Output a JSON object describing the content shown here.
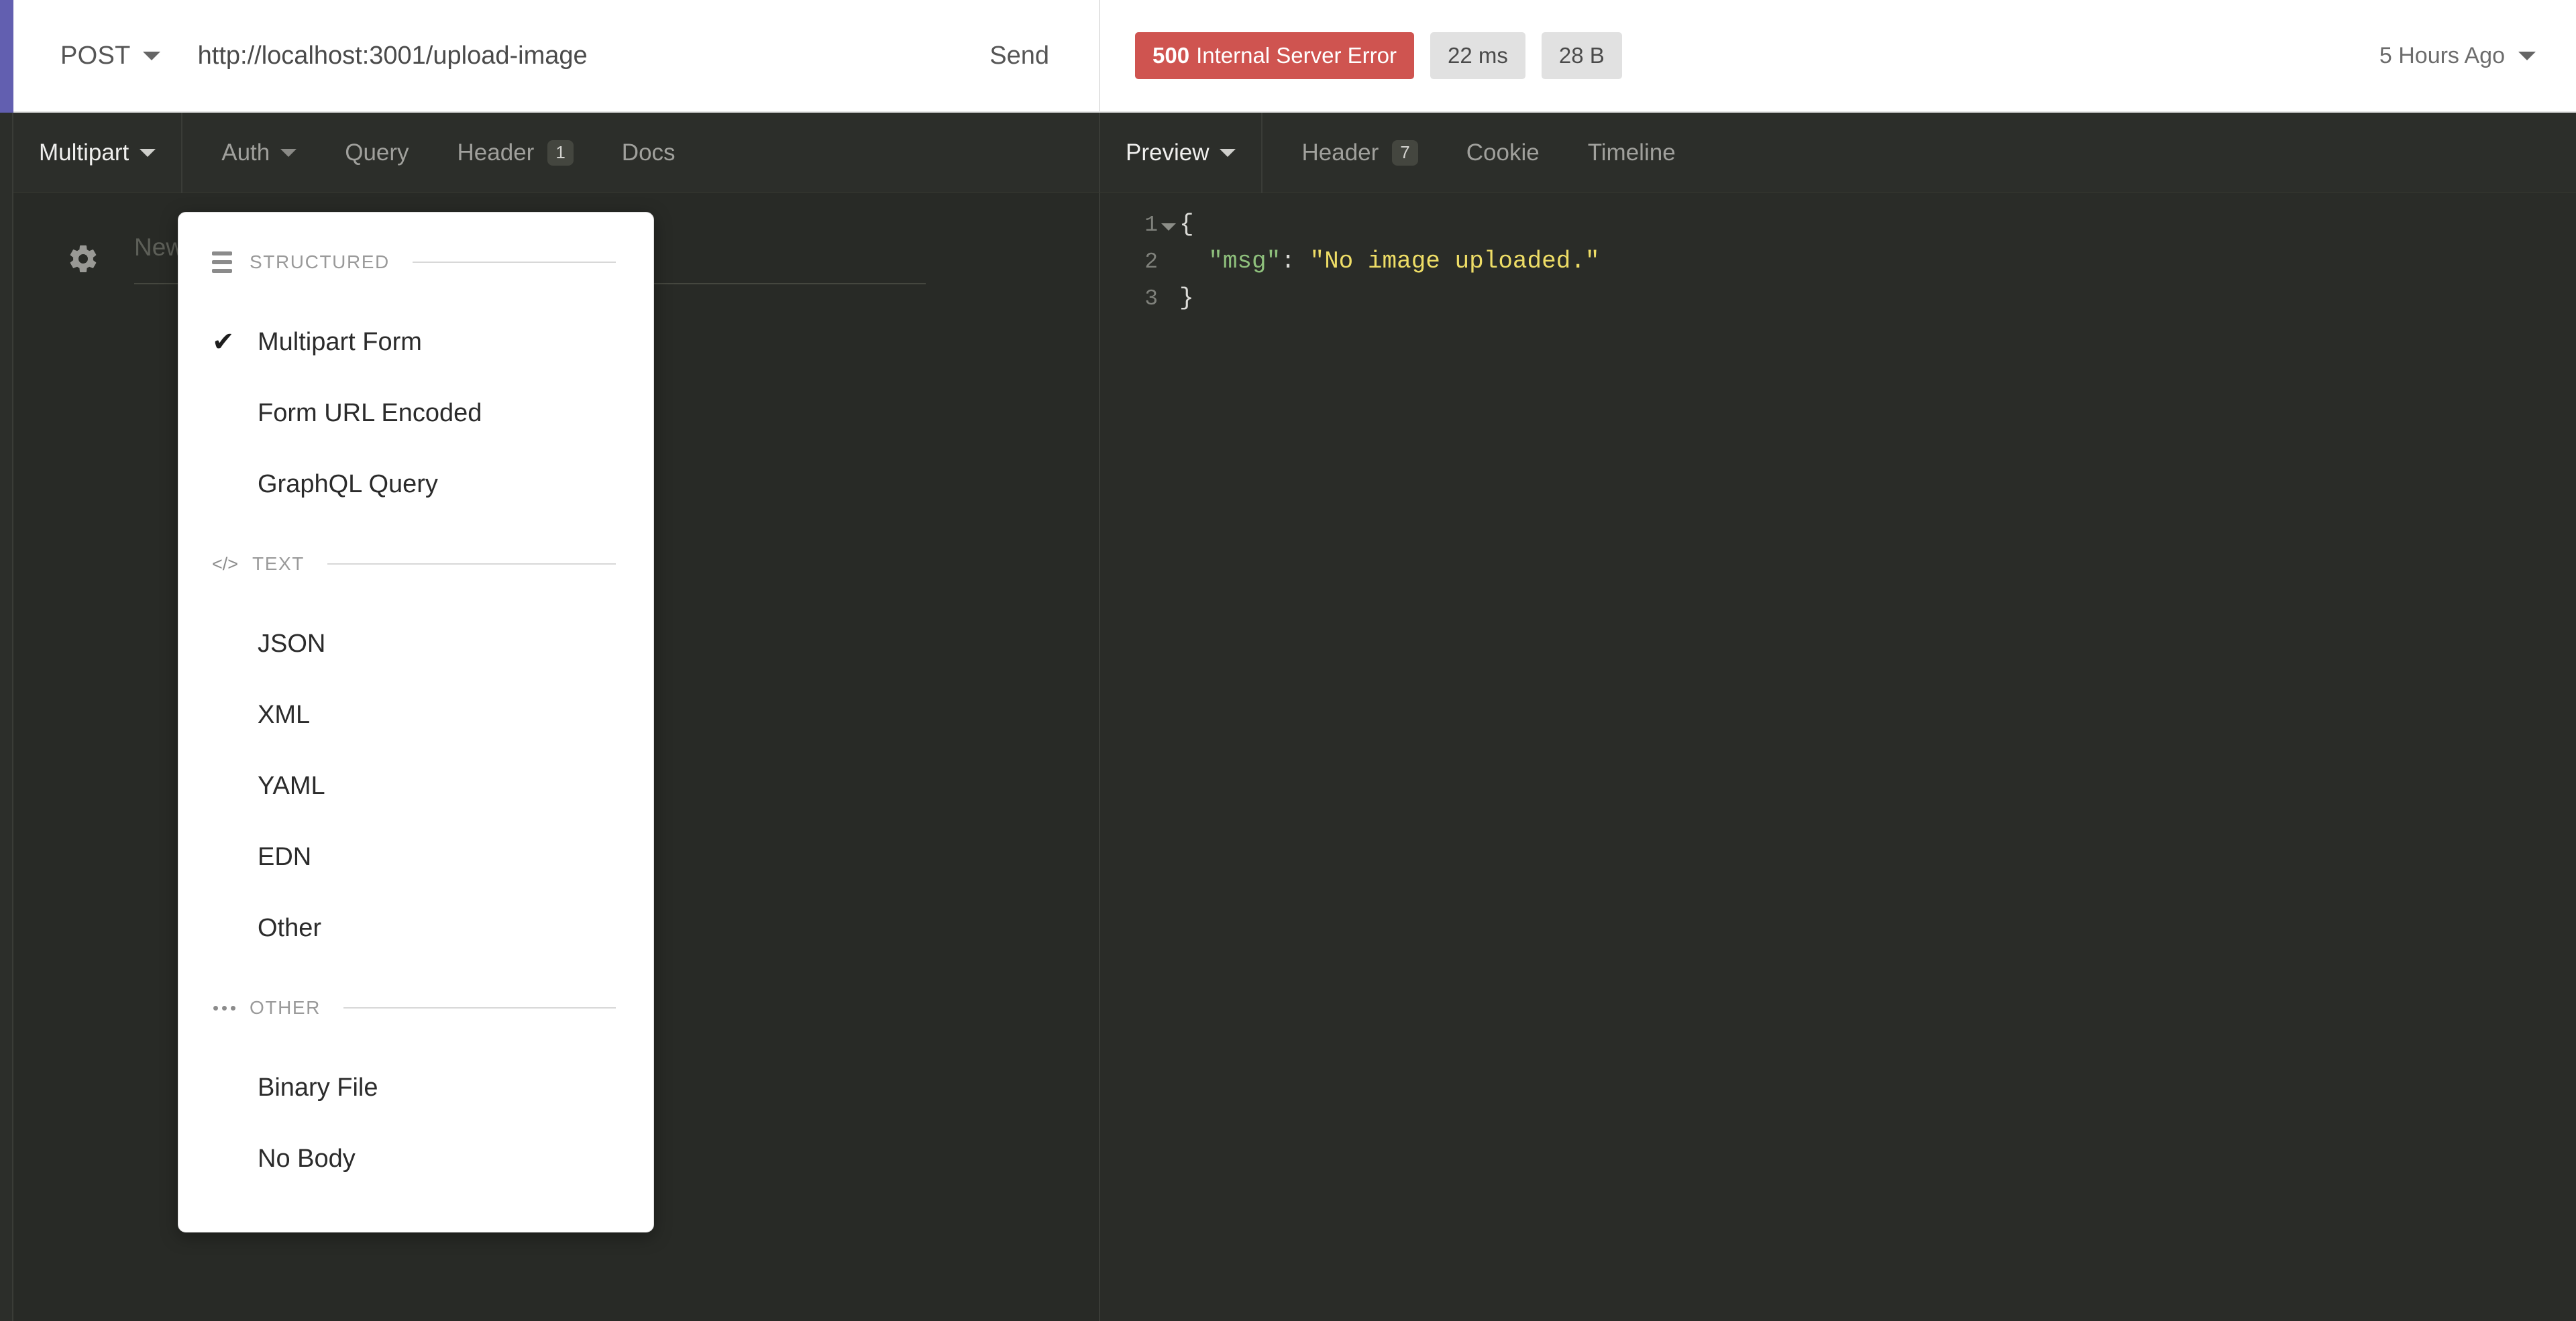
{
  "request_bar": {
    "method": "POST",
    "method_caret_icon": "chevron-down-icon",
    "url": "http://localhost:3001/upload-image",
    "send_label": "Send"
  },
  "response_bar": {
    "status_code": "500",
    "status_text": "Internal Server Error",
    "status_color": "#cf5450",
    "time": "22 ms",
    "size": "28 B",
    "timestamp": "5 Hours Ago",
    "timestamp_caret_icon": "chevron-down-icon"
  },
  "request_tabs": {
    "body_tab": {
      "label": "Multipart",
      "caret_icon": "chevron-down-icon",
      "active": true
    },
    "items": [
      {
        "label": "Auth",
        "caret_icon": "chevron-down-icon",
        "badge": ""
      },
      {
        "label": "Query",
        "badge": ""
      },
      {
        "label": "Header",
        "badge": "1"
      },
      {
        "label": "Docs",
        "badge": ""
      }
    ]
  },
  "response_tabs": {
    "preview_tab": {
      "label": "Preview",
      "caret_icon": "chevron-down-icon",
      "active": true
    },
    "items": [
      {
        "label": "Header",
        "badge": "7"
      },
      {
        "label": "Cookie",
        "badge": ""
      },
      {
        "label": "Timeline",
        "badge": ""
      }
    ]
  },
  "request_body": {
    "settings_icon": "gear-icon",
    "name_placeholder": "New Multipart Value"
  },
  "response_body": {
    "lines": [
      {
        "number": "1",
        "foldable": true,
        "text": "{"
      },
      {
        "number": "2",
        "foldable": false,
        "key": "\"msg\"",
        "punct": ": ",
        "value": "\"No image uploaded.\""
      },
      {
        "number": "3",
        "foldable": false,
        "text": "}"
      }
    ],
    "colors": {
      "key": "#8ec07c",
      "string": "#eedd66",
      "punctuation": "#dcdcd8",
      "line_number": "#7f817b"
    }
  },
  "body_type_menu": {
    "sections": [
      {
        "icon": "hamburger-icon",
        "label": "STRUCTURED",
        "items": [
          {
            "label": "Multipart Form",
            "checked": true
          },
          {
            "label": "Form URL Encoded",
            "checked": false
          },
          {
            "label": "GraphQL Query",
            "checked": false
          }
        ]
      },
      {
        "icon": "code-icon",
        "label": "TEXT",
        "items": [
          {
            "label": "JSON",
            "checked": false
          },
          {
            "label": "XML",
            "checked": false
          },
          {
            "label": "YAML",
            "checked": false
          },
          {
            "label": "EDN",
            "checked": false
          },
          {
            "label": "Other",
            "checked": false
          }
        ]
      },
      {
        "icon": "ellipsis-icon",
        "label": "OTHER",
        "items": [
          {
            "label": "Binary File",
            "checked": false
          },
          {
            "label": "No Body",
            "checked": false
          }
        ]
      }
    ],
    "check_glyph": "✔"
  }
}
